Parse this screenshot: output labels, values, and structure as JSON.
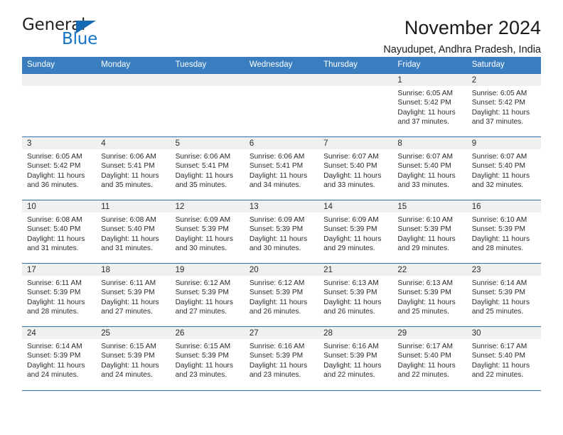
{
  "logo": {
    "word_top": "General",
    "word_bottom": "Blue",
    "triangle_color": "#1669b4",
    "blue_color": "#1273c4"
  },
  "header": {
    "title": "November 2024",
    "subtitle": "Nayudupet, Andhra Pradesh, India"
  },
  "theme": {
    "header_bg": "#3b7ec0",
    "row_border": "#2f6fb0",
    "daynum_band": "#f0f0f0"
  },
  "weekday_headers": [
    "Sunday",
    "Monday",
    "Tuesday",
    "Wednesday",
    "Thursday",
    "Friday",
    "Saturday"
  ],
  "weeks": [
    [
      {
        "day": "",
        "sunrise": "",
        "sunset": "",
        "daylight1": "",
        "daylight2": ""
      },
      {
        "day": "",
        "sunrise": "",
        "sunset": "",
        "daylight1": "",
        "daylight2": ""
      },
      {
        "day": "",
        "sunrise": "",
        "sunset": "",
        "daylight1": "",
        "daylight2": ""
      },
      {
        "day": "",
        "sunrise": "",
        "sunset": "",
        "daylight1": "",
        "daylight2": ""
      },
      {
        "day": "",
        "sunrise": "",
        "sunset": "",
        "daylight1": "",
        "daylight2": ""
      },
      {
        "day": "1",
        "sunrise": "Sunrise: 6:05 AM",
        "sunset": "Sunset: 5:42 PM",
        "daylight1": "Daylight: 11 hours",
        "daylight2": "and 37 minutes."
      },
      {
        "day": "2",
        "sunrise": "Sunrise: 6:05 AM",
        "sunset": "Sunset: 5:42 PM",
        "daylight1": "Daylight: 11 hours",
        "daylight2": "and 37 minutes."
      }
    ],
    [
      {
        "day": "3",
        "sunrise": "Sunrise: 6:05 AM",
        "sunset": "Sunset: 5:42 PM",
        "daylight1": "Daylight: 11 hours",
        "daylight2": "and 36 minutes."
      },
      {
        "day": "4",
        "sunrise": "Sunrise: 6:06 AM",
        "sunset": "Sunset: 5:41 PM",
        "daylight1": "Daylight: 11 hours",
        "daylight2": "and 35 minutes."
      },
      {
        "day": "5",
        "sunrise": "Sunrise: 6:06 AM",
        "sunset": "Sunset: 5:41 PM",
        "daylight1": "Daylight: 11 hours",
        "daylight2": "and 35 minutes."
      },
      {
        "day": "6",
        "sunrise": "Sunrise: 6:06 AM",
        "sunset": "Sunset: 5:41 PM",
        "daylight1": "Daylight: 11 hours",
        "daylight2": "and 34 minutes."
      },
      {
        "day": "7",
        "sunrise": "Sunrise: 6:07 AM",
        "sunset": "Sunset: 5:40 PM",
        "daylight1": "Daylight: 11 hours",
        "daylight2": "and 33 minutes."
      },
      {
        "day": "8",
        "sunrise": "Sunrise: 6:07 AM",
        "sunset": "Sunset: 5:40 PM",
        "daylight1": "Daylight: 11 hours",
        "daylight2": "and 33 minutes."
      },
      {
        "day": "9",
        "sunrise": "Sunrise: 6:07 AM",
        "sunset": "Sunset: 5:40 PM",
        "daylight1": "Daylight: 11 hours",
        "daylight2": "and 32 minutes."
      }
    ],
    [
      {
        "day": "10",
        "sunrise": "Sunrise: 6:08 AM",
        "sunset": "Sunset: 5:40 PM",
        "daylight1": "Daylight: 11 hours",
        "daylight2": "and 31 minutes."
      },
      {
        "day": "11",
        "sunrise": "Sunrise: 6:08 AM",
        "sunset": "Sunset: 5:40 PM",
        "daylight1": "Daylight: 11 hours",
        "daylight2": "and 31 minutes."
      },
      {
        "day": "12",
        "sunrise": "Sunrise: 6:09 AM",
        "sunset": "Sunset: 5:39 PM",
        "daylight1": "Daylight: 11 hours",
        "daylight2": "and 30 minutes."
      },
      {
        "day": "13",
        "sunrise": "Sunrise: 6:09 AM",
        "sunset": "Sunset: 5:39 PM",
        "daylight1": "Daylight: 11 hours",
        "daylight2": "and 30 minutes."
      },
      {
        "day": "14",
        "sunrise": "Sunrise: 6:09 AM",
        "sunset": "Sunset: 5:39 PM",
        "daylight1": "Daylight: 11 hours",
        "daylight2": "and 29 minutes."
      },
      {
        "day": "15",
        "sunrise": "Sunrise: 6:10 AM",
        "sunset": "Sunset: 5:39 PM",
        "daylight1": "Daylight: 11 hours",
        "daylight2": "and 29 minutes."
      },
      {
        "day": "16",
        "sunrise": "Sunrise: 6:10 AM",
        "sunset": "Sunset: 5:39 PM",
        "daylight1": "Daylight: 11 hours",
        "daylight2": "and 28 minutes."
      }
    ],
    [
      {
        "day": "17",
        "sunrise": "Sunrise: 6:11 AM",
        "sunset": "Sunset: 5:39 PM",
        "daylight1": "Daylight: 11 hours",
        "daylight2": "and 28 minutes."
      },
      {
        "day": "18",
        "sunrise": "Sunrise: 6:11 AM",
        "sunset": "Sunset: 5:39 PM",
        "daylight1": "Daylight: 11 hours",
        "daylight2": "and 27 minutes."
      },
      {
        "day": "19",
        "sunrise": "Sunrise: 6:12 AM",
        "sunset": "Sunset: 5:39 PM",
        "daylight1": "Daylight: 11 hours",
        "daylight2": "and 27 minutes."
      },
      {
        "day": "20",
        "sunrise": "Sunrise: 6:12 AM",
        "sunset": "Sunset: 5:39 PM",
        "daylight1": "Daylight: 11 hours",
        "daylight2": "and 26 minutes."
      },
      {
        "day": "21",
        "sunrise": "Sunrise: 6:13 AM",
        "sunset": "Sunset: 5:39 PM",
        "daylight1": "Daylight: 11 hours",
        "daylight2": "and 26 minutes."
      },
      {
        "day": "22",
        "sunrise": "Sunrise: 6:13 AM",
        "sunset": "Sunset: 5:39 PM",
        "daylight1": "Daylight: 11 hours",
        "daylight2": "and 25 minutes."
      },
      {
        "day": "23",
        "sunrise": "Sunrise: 6:14 AM",
        "sunset": "Sunset: 5:39 PM",
        "daylight1": "Daylight: 11 hours",
        "daylight2": "and 25 minutes."
      }
    ],
    [
      {
        "day": "24",
        "sunrise": "Sunrise: 6:14 AM",
        "sunset": "Sunset: 5:39 PM",
        "daylight1": "Daylight: 11 hours",
        "daylight2": "and 24 minutes."
      },
      {
        "day": "25",
        "sunrise": "Sunrise: 6:15 AM",
        "sunset": "Sunset: 5:39 PM",
        "daylight1": "Daylight: 11 hours",
        "daylight2": "and 24 minutes."
      },
      {
        "day": "26",
        "sunrise": "Sunrise: 6:15 AM",
        "sunset": "Sunset: 5:39 PM",
        "daylight1": "Daylight: 11 hours",
        "daylight2": "and 23 minutes."
      },
      {
        "day": "27",
        "sunrise": "Sunrise: 6:16 AM",
        "sunset": "Sunset: 5:39 PM",
        "daylight1": "Daylight: 11 hours",
        "daylight2": "and 23 minutes."
      },
      {
        "day": "28",
        "sunrise": "Sunrise: 6:16 AM",
        "sunset": "Sunset: 5:39 PM",
        "daylight1": "Daylight: 11 hours",
        "daylight2": "and 22 minutes."
      },
      {
        "day": "29",
        "sunrise": "Sunrise: 6:17 AM",
        "sunset": "Sunset: 5:40 PM",
        "daylight1": "Daylight: 11 hours",
        "daylight2": "and 22 minutes."
      },
      {
        "day": "30",
        "sunrise": "Sunrise: 6:17 AM",
        "sunset": "Sunset: 5:40 PM",
        "daylight1": "Daylight: 11 hours",
        "daylight2": "and 22 minutes."
      }
    ]
  ]
}
